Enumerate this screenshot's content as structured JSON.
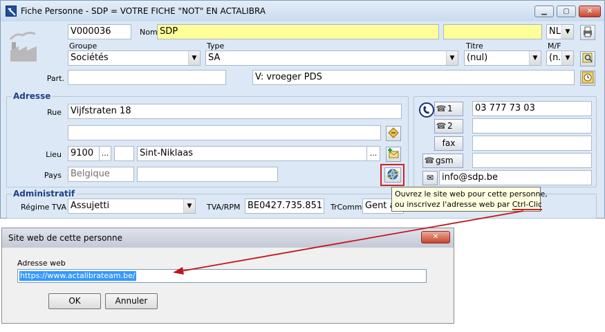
{
  "window": {
    "title": "Fiche Personne - SDP  = VOTRE FICHE \"NOT\" EN ACTALIBRA",
    "minimize": "▁",
    "maximize": "▢",
    "close": "✕"
  },
  "header": {
    "code": "V000036",
    "nom_label": "Nom",
    "nom_value": "SDP",
    "nom2_value": "",
    "lang_value": "NL",
    "groupe_label": "Groupe",
    "groupe_value": "Sociétés",
    "type_label": "Type",
    "type_value": "SA",
    "titre_label": "Titre",
    "titre_value": "(nul)",
    "mf_label": "M/F",
    "mf_value": "(n.a",
    "part_label": "Part.",
    "part_value": "",
    "extra_value": "V: vroeger PDS"
  },
  "address": {
    "section_title": "Adresse",
    "rue_label": "Rue",
    "rue_value": "Vijfstraten 18",
    "rue2_value": "",
    "lieu_label": "Lieu",
    "lieu_code": "9100",
    "lieu_more": "...",
    "lieu_box": "",
    "lieu_city": "Sint-Niklaas",
    "city_more": "...",
    "pays_label": "Pays",
    "pays_value": "Belgique",
    "pays_extra": ""
  },
  "phones": {
    "btn1": "1",
    "value1": "03 777 73 03",
    "btn2": "2",
    "value2": "",
    "fax_label": "fax",
    "fax_value": "",
    "gsm_label": "gsm",
    "gsm_value": "",
    "email_value": "info@sdp.be"
  },
  "tooltip": {
    "line1": "Ouvrez le site web pour cette personne,",
    "line2_prefix": "ou inscrivez l'adresse web par ",
    "line2_key": "Ctrl-Clic"
  },
  "admin": {
    "section_title": "Administratif",
    "regime_label": "Régime TVA",
    "regime_value": "Assujetti",
    "tva_label": "TVA/RPM",
    "tva_value": "BE0427.735.851",
    "trcomm_label": "TrComm",
    "trcomm_value": "Gent at"
  },
  "dialog": {
    "title": "Site web de cette personne",
    "close": "✕",
    "field_label": "Adresse web",
    "url_value": "https://www.actalibrateam.be/",
    "ok_label": "OK",
    "cancel_label": "Annuler"
  },
  "colors": {
    "arrow": "#c0151b",
    "highlight_border": "#d12020",
    "nom_bg": "#ffff99",
    "url_selection": "#3399ff"
  }
}
